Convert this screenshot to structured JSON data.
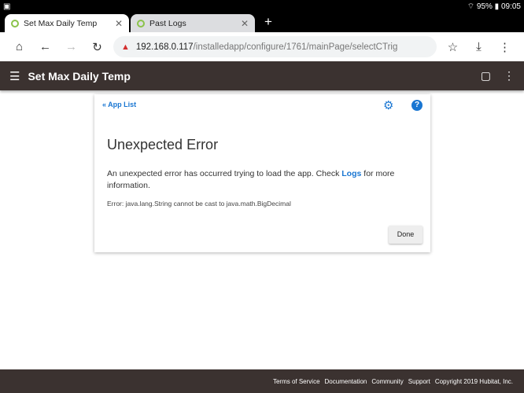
{
  "status": {
    "battery": "95%",
    "time": "09:05"
  },
  "tabs": [
    {
      "label": "Set Max Daily Temp"
    },
    {
      "label": "Past Logs"
    }
  ],
  "url": {
    "host": "192.168.0.117",
    "path": "/installedapp/configure/1761/mainPage/selectCTrig"
  },
  "appbar": {
    "title": "Set Max Daily Temp"
  },
  "card": {
    "app_list": "« App List",
    "heading": "Unexpected Error",
    "message_before": "An unexpected error has occurred trying to load the app. Check ",
    "logs_link": "Logs",
    "message_after": " for more information.",
    "error": "Error: java.lang.String cannot be cast to java.math.BigDecimal",
    "done": "Done"
  },
  "footer": [
    "Terms of Service",
    "Documentation",
    "Community",
    "Support",
    "Copyright 2019 Hubitat, Inc."
  ],
  "colors": {
    "accent": "#1976d2",
    "appbar": "#3b3230"
  }
}
